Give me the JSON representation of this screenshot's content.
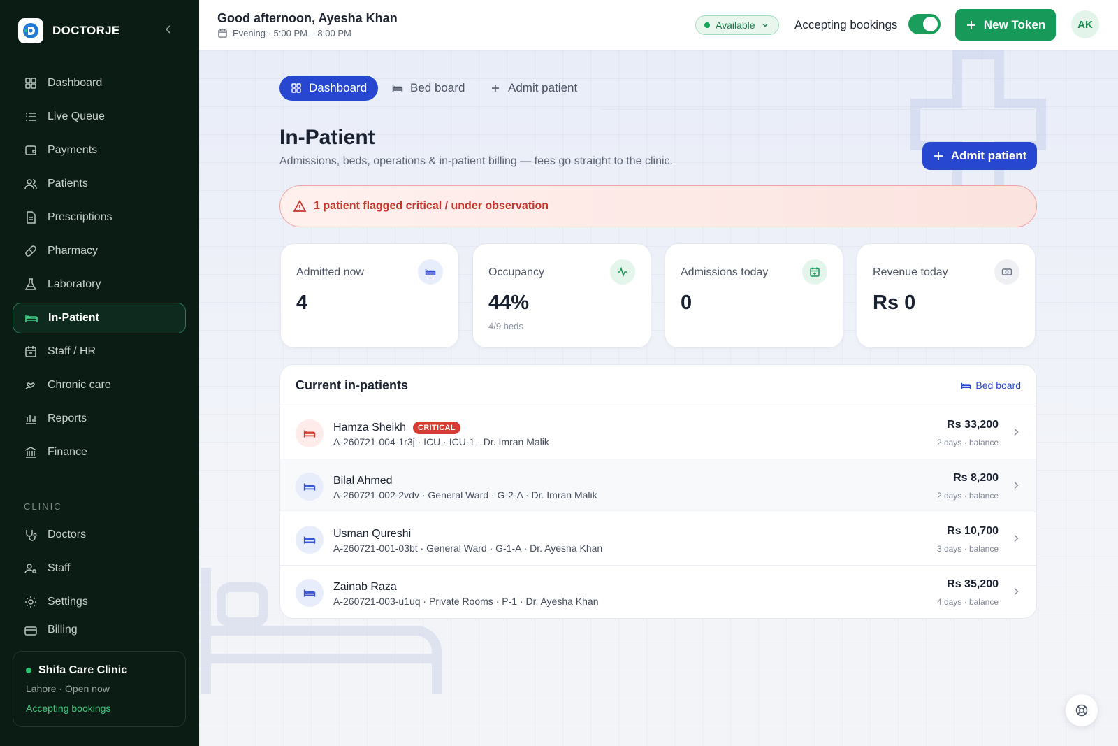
{
  "brand": {
    "name": "DOCTORJE"
  },
  "sidebar": {
    "items": [
      {
        "label": "Dashboard",
        "icon": "dashboard-icon"
      },
      {
        "label": "Live Queue",
        "icon": "list-icon"
      },
      {
        "label": "Payments",
        "icon": "wallet-icon"
      },
      {
        "label": "Patients",
        "icon": "users-icon"
      },
      {
        "label": "Prescriptions",
        "icon": "document-icon"
      },
      {
        "label": "Pharmacy",
        "icon": "pill-icon"
      },
      {
        "label": "Laboratory",
        "icon": "flask-icon"
      },
      {
        "label": "In-Patient",
        "icon": "bed-icon",
        "active": true
      },
      {
        "label": "Staff / HR",
        "icon": "calendar-icon"
      },
      {
        "label": "Chronic care",
        "icon": "heart-hand-icon"
      },
      {
        "label": "Reports",
        "icon": "bar-chart-icon"
      },
      {
        "label": "Finance",
        "icon": "bank-icon"
      }
    ],
    "section_label": "CLINIC",
    "clinic_items": [
      {
        "label": "Doctors",
        "icon": "stethoscope-icon"
      },
      {
        "label": "Staff",
        "icon": "user-cog-icon"
      },
      {
        "label": "Settings",
        "icon": "gear-icon"
      },
      {
        "label": "Billing",
        "icon": "card-icon"
      }
    ],
    "clinic": {
      "name": "Shifa Care Clinic",
      "location": "Lahore · Open now",
      "status": "Accepting bookings"
    }
  },
  "header": {
    "greeting": "Good afternoon, Ayesha Khan",
    "shift": "Evening · 5:00 PM – 8:00 PM",
    "availability": "Available",
    "accepting_label": "Accepting bookings",
    "accepting_on": true,
    "new_token": "New Token",
    "avatar_initials": "AK"
  },
  "tabs": [
    {
      "label": "Dashboard",
      "active": true
    },
    {
      "label": "Bed board"
    },
    {
      "label": "Admit patient"
    }
  ],
  "page": {
    "title": "In-Patient",
    "subtitle": "Admissions, beds, operations & in-patient billing — fees go straight to the clinic.",
    "admit_button": "Admit patient",
    "alert": "1 patient flagged critical / under observation"
  },
  "stats": [
    {
      "label": "Admitted now",
      "value": "4",
      "sub": "",
      "icon": "bed-icon",
      "icon_color": "#3a56d4",
      "icon_bg": "#e8edfb"
    },
    {
      "label": "Occupancy",
      "value": "44%",
      "sub": "4/9 beds",
      "icon": "pulse-icon",
      "icon_color": "#1c9a5c",
      "icon_bg": "#e4f5ec"
    },
    {
      "label": "Admissions today",
      "value": "0",
      "sub": "",
      "icon": "calendar-plus-icon",
      "icon_color": "#1c9a5c",
      "icon_bg": "#e4f5ec"
    },
    {
      "label": "Revenue today",
      "value": "Rs 0",
      "sub": "",
      "icon": "cash-icon",
      "icon_color": "#6b7384",
      "icon_bg": "#eef0f4"
    }
  ],
  "inpatients": {
    "title": "Current in-patients",
    "link": "Bed board",
    "rows": [
      {
        "name": "Hamza Sheikh",
        "badge": "CRITICAL",
        "meta": "A-260721-004-1r3j · ICU · ICU-1 · Dr. Imran Malik",
        "amount": "Rs 33,200",
        "days": "2 days · balance",
        "critical": true
      },
      {
        "name": "Bilal Ahmed",
        "badge": "",
        "meta": "A-260721-002-2vdv · General Ward · G-2-A · Dr. Imran Malik",
        "amount": "Rs 8,200",
        "days": "2 days · balance",
        "critical": false
      },
      {
        "name": "Usman Qureshi",
        "badge": "",
        "meta": "A-260721-001-03bt · General Ward · G-1-A · Dr. Ayesha Khan",
        "amount": "Rs 10,700",
        "days": "3 days · balance",
        "critical": false
      },
      {
        "name": "Zainab Raza",
        "badge": "",
        "meta": "A-260721-003-u1uq · Private Rooms · P-1 · Dr. Ayesha Khan",
        "amount": "Rs 35,200",
        "days": "4 days · balance",
        "critical": false
      }
    ]
  },
  "colors": {
    "sidebar_bg": "#0b1c14",
    "accent_green": "#17995a",
    "accent_blue": "#2747d0",
    "critical": "#d63c32"
  }
}
